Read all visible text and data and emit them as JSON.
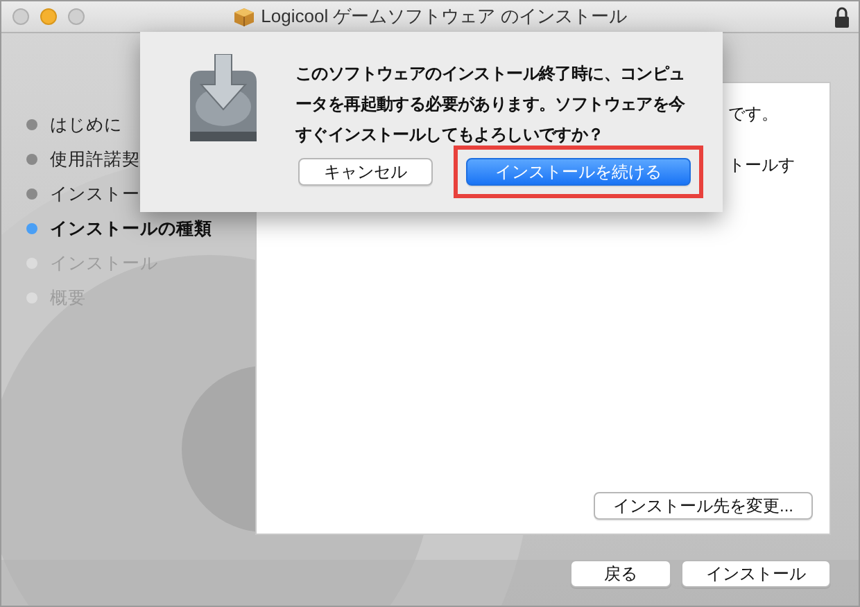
{
  "window": {
    "title": "Logicool ゲームソフトウェア のインストール"
  },
  "steps": [
    {
      "label": "はじめに",
      "disabled": false,
      "selected": false
    },
    {
      "label": "使用許諾契",
      "disabled": false,
      "selected": false
    },
    {
      "label": "インストー",
      "disabled": false,
      "selected": false
    },
    {
      "label": "インストールの種類",
      "disabled": false,
      "selected": true
    },
    {
      "label": "インストール",
      "disabled": true,
      "selected": false
    },
    {
      "label": "概要",
      "disabled": true,
      "selected": false
    }
  ],
  "panel": {
    "text_lines": [
      "です。",
      "トールす"
    ],
    "change_location_button": "インストール先を変更..."
  },
  "footer_buttons": [
    {
      "label": "戻る"
    },
    {
      "label": "インストール"
    }
  ],
  "dialog": {
    "message_lines": [
      "このソフトウェアのインストール終了時に、コンピュ",
      "ータを再起動する必要があります。ソフトウェアを今",
      "すぐインストールしてもよろしいですか？"
    ],
    "buttons": [
      {
        "label": "キャンセル",
        "kind": "plain",
        "highlighted": false
      },
      {
        "label": "インストールを続ける",
        "kind": "default",
        "highlighted": true
      }
    ]
  }
}
